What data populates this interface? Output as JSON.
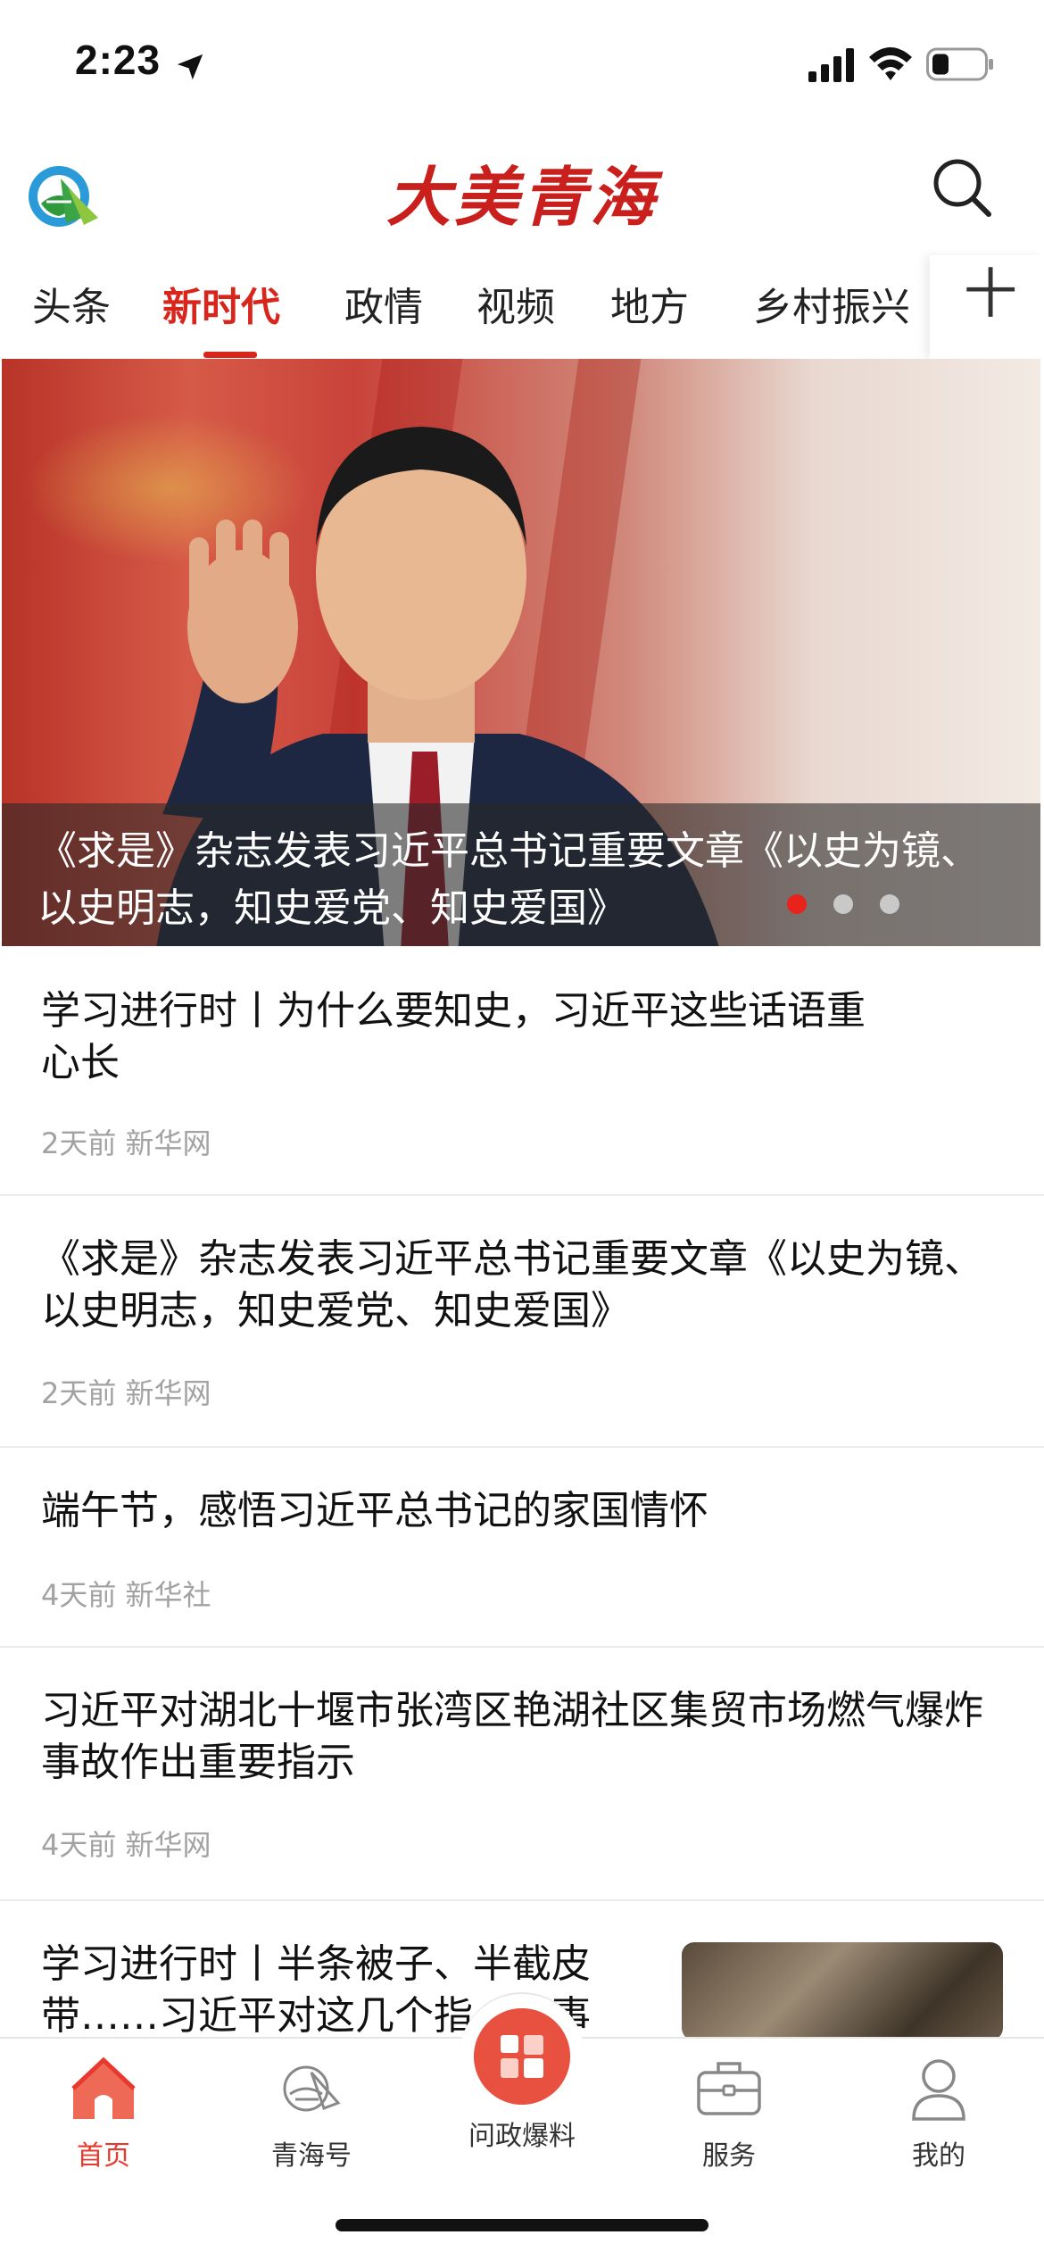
{
  "status_bar": {
    "time": "2:23"
  },
  "header": {
    "brand": "大美青海"
  },
  "tabs": [
    {
      "label": "头条",
      "active": false
    },
    {
      "label": "新时代",
      "active": true
    },
    {
      "label": "政情",
      "active": false
    },
    {
      "label": "视频",
      "active": false
    },
    {
      "label": "地方",
      "active": false
    },
    {
      "label": "乡村振兴",
      "active": false
    }
  ],
  "tab_add_label": "十",
  "hero": {
    "title": "《求是》杂志发表习近平总书记重要文章《以史为镜、以史明志，知史爱党、知史爱国》",
    "slide_count": 3,
    "active_slide": 1
  },
  "news": [
    {
      "title": "学习进行时丨为什么要知史，习近平这些话语重心长",
      "time": "2天前",
      "source": "新华网"
    },
    {
      "title": "《求是》杂志发表习近平总书记重要文章《以史为镜、以史明志，知史爱党、知史爱国》",
      "time": "2天前",
      "source": "新华网"
    },
    {
      "title": "端午节，感悟习近平总书记的家国情怀",
      "time": "4天前",
      "source": "新华社"
    },
    {
      "title": "习近平对湖北十堰市张湾区艳湖社区集贸市场燃气爆炸事故作出重要指示",
      "time": "4天前",
      "source": "新华网"
    },
    {
      "title": "学习进行时丨半条被子、半截皮带……习近平对这几个指…故事",
      "time": "",
      "source": ""
    }
  ],
  "bottom_nav": [
    {
      "label": "首页",
      "active": true
    },
    {
      "label": "青海号",
      "active": false
    },
    {
      "label": "问政爆料",
      "active": false
    },
    {
      "label": "服务",
      "active": false
    },
    {
      "label": "我的",
      "active": false
    }
  ],
  "colors": {
    "accent": "#d9261c",
    "brand": "#c9201d",
    "meta_text": "#a2a2a2",
    "nav_active": "#e8392e"
  }
}
